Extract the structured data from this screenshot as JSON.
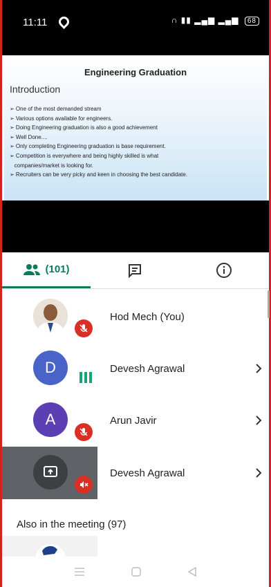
{
  "status_bar": {
    "time": "11:11",
    "battery": "68"
  },
  "slide": {
    "title": "Engineering Graduation",
    "subtitle": "Introduction",
    "bullets": [
      "➢ One of the most demanded stream",
      "➢ Various options available for engineers.",
      "➢ Doing Engineering graduation is also a good achievement",
      "➢ Well Done....",
      "➢ Only completing Engineering  graduation is base requirement.",
      "➢ Competition is everywhere and being highly skilled is what",
      "   companies/market is looking for.",
      "➢ Recruiters can be very picky and keen in choosing the best candidate."
    ]
  },
  "tabs": {
    "people_count": "(101)"
  },
  "participants": [
    {
      "name": "Hod Mech (You)",
      "initial": "",
      "avatar_color": "#c7b9a8",
      "status": "muted"
    },
    {
      "name": "Devesh Agrawal",
      "initial": "D",
      "avatar_color": "#4a63c8",
      "status": "talking"
    },
    {
      "name": "Arun Javir",
      "initial": "A",
      "avatar_color": "#5b3fb3",
      "status": "muted"
    },
    {
      "name": "Devesh Agrawal",
      "initial": "",
      "avatar_color": "#3c4043",
      "status": "presenting-muted"
    }
  ],
  "also_in_meeting": "Also in the meeting (97)",
  "colors": {
    "accent": "#0a7c5c",
    "mute_red": "#d93025",
    "talk_green": "#1aa37a"
  }
}
